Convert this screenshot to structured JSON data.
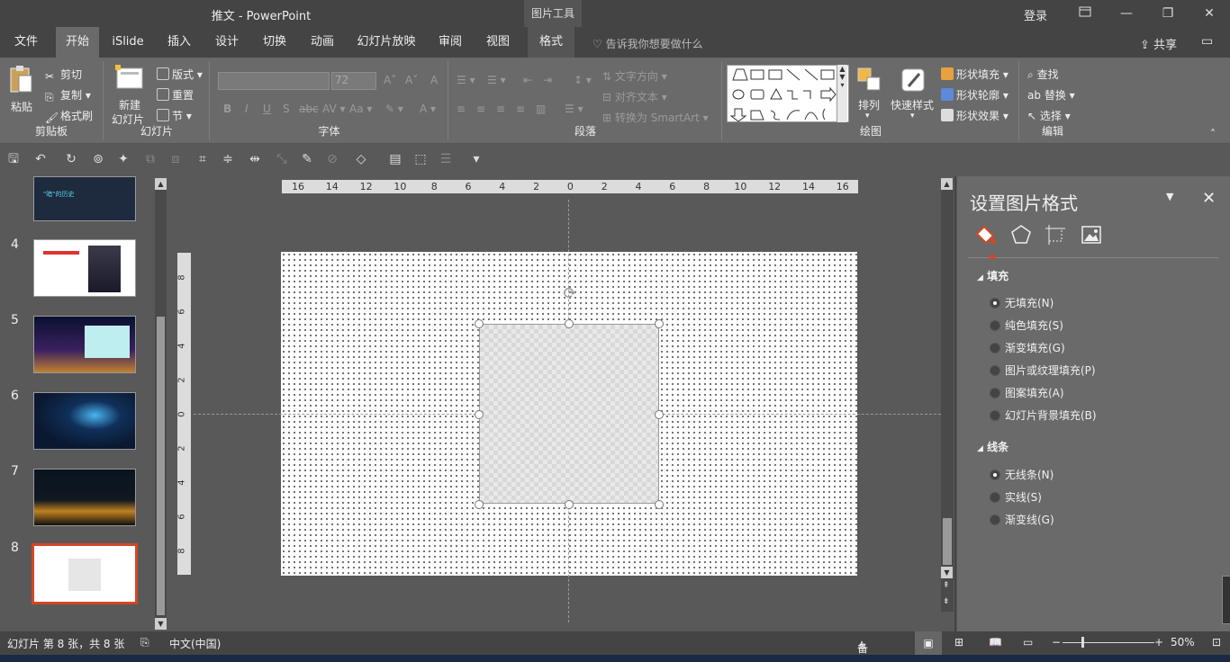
{
  "window": {
    "title": "推文  -  PowerPoint",
    "context_tab_group": "图片工具",
    "login": "登录",
    "share": "共享",
    "accent": "#d24726"
  },
  "tabs": [
    "文件",
    "开始",
    "iSlide",
    "插入",
    "设计",
    "切换",
    "动画",
    "幻灯片放映",
    "审阅",
    "视图",
    "格式"
  ],
  "active_tab": "开始",
  "tell_me": "告诉我你想要做什么",
  "ribbon": {
    "clipboard": {
      "label": "剪贴板",
      "paste": "粘贴",
      "cut": "剪切",
      "copy": "复制",
      "format_painter": "格式刷"
    },
    "slides": {
      "label": "幻灯片",
      "new_slide_1": "新建",
      "new_slide_2": "幻灯片",
      "layout": "版式",
      "reset": "重置",
      "section": "节"
    },
    "font": {
      "label": "字体",
      "font_name": "",
      "font_size": "72",
      "bold": "B",
      "italic": "I",
      "underline": "U",
      "shadow": "S",
      "strike": "abc",
      "spacing": "AV",
      "case": "Aa",
      "clear": "A",
      "grow": "A",
      "shrink": "A",
      "color": "A"
    },
    "paragraph": {
      "label": "段落",
      "text_direction": "文字方向",
      "align_text": "对齐文本",
      "smartart": "转换为 SmartArt"
    },
    "drawing": {
      "label": "绘图",
      "arrange": "排列",
      "quick_styles": "快速样式",
      "shape_fill": "形状填充",
      "shape_outline": "形状轮廓",
      "shape_effects": "形状效果"
    },
    "editing": {
      "label": "编辑",
      "find": "查找",
      "replace": "替换",
      "select": "选择"
    }
  },
  "thumbnails": [
    {
      "num": "4",
      "title": ""
    },
    {
      "num": "5",
      "title": ""
    },
    {
      "num": "6",
      "title": ""
    },
    {
      "num": "7",
      "title": ""
    },
    {
      "num": "8",
      "title": ""
    }
  ],
  "thumb3_title": "\"暗\"的历史",
  "ruler": {
    "h_ticks": [
      "16",
      "14",
      "12",
      "10",
      "8",
      "6",
      "4",
      "2",
      "0",
      "2",
      "4",
      "6",
      "8",
      "10",
      "12",
      "14",
      "16"
    ],
    "v_ticks": [
      "8",
      "6",
      "4",
      "2",
      "0",
      "2",
      "4",
      "6",
      "8"
    ]
  },
  "format_pane": {
    "title": "设置图片格式",
    "fill_section": "填充",
    "fill_options": [
      "无填充(N)",
      "纯色填充(S)",
      "渐变填充(G)",
      "图片或纹理填充(P)",
      "图案填充(A)",
      "幻灯片背景填充(B)"
    ],
    "fill_selected": 0,
    "line_section": "线条",
    "line_options": [
      "无线条(N)",
      "实线(S)",
      "渐变线(G)"
    ],
    "line_selected": 0
  },
  "status": {
    "slide_info": "幻灯片 第 8 张，共 8 张",
    "language": "中文(中国)",
    "notes": "备注",
    "zoom": "50%"
  }
}
